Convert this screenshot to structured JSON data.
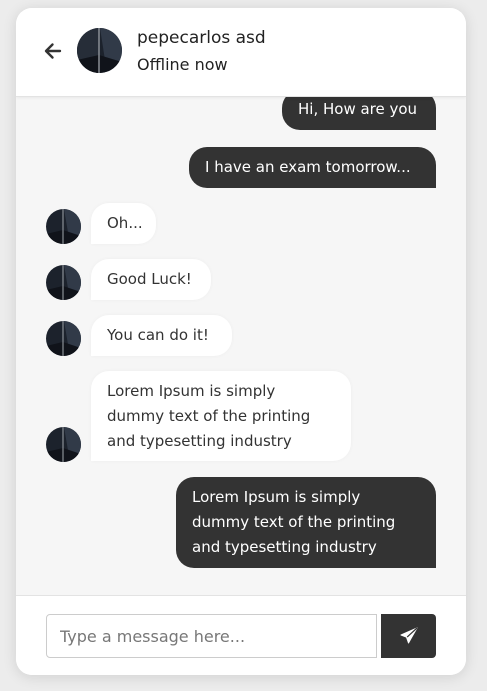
{
  "header": {
    "name": "pepecarlos asd",
    "status": "Offline now",
    "back_icon": "arrow-left-icon",
    "avatar_icon": "profile-photo"
  },
  "messages": [
    {
      "direction": "outgoing",
      "text": "Hi, How are you"
    },
    {
      "direction": "outgoing",
      "text": "I have an exam tomorrow..."
    },
    {
      "direction": "incoming",
      "text": "Oh..."
    },
    {
      "direction": "incoming",
      "text": "Good Luck!"
    },
    {
      "direction": "incoming",
      "text": "You can do it!"
    },
    {
      "direction": "incoming",
      "lines": [
        "Lorem Ipsum is simply",
        "dummy text of the printing",
        "and typesetting industry"
      ]
    },
    {
      "direction": "outgoing",
      "lines": [
        "Lorem Ipsum is simply",
        "dummy text of the printing",
        "and typesetting industry"
      ]
    }
  ],
  "composer": {
    "placeholder": "Type a message here...",
    "send_icon": "paper-plane-icon"
  },
  "colors": {
    "outgoing_bubble": "#333333",
    "incoming_bubble": "#ffffff",
    "chat_background": "#f6f6f6"
  }
}
